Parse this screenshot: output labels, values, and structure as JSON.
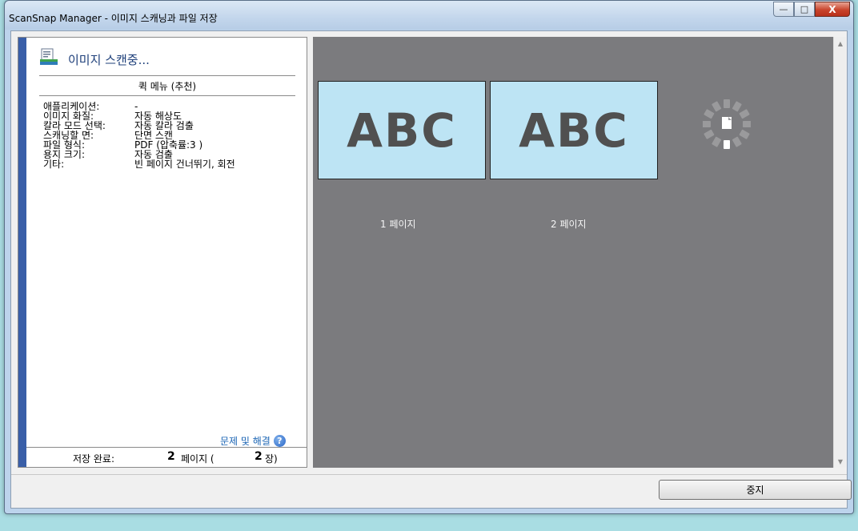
{
  "window": {
    "title": "ScanSnap Manager - 이미지 스캐닝과 파일 저장",
    "controls": {
      "minimize": "—",
      "maximize": "□",
      "close": "X"
    }
  },
  "left_panel": {
    "status": "이미지 스캔중...",
    "quick_menu_title": "퀵 메뉴 (추천)",
    "settings": [
      {
        "label": "애플리케이션:",
        "value": "-"
      },
      {
        "label": "이미지 화질:",
        "value": "자동 해상도"
      },
      {
        "label": "칼라 모드 선택:",
        "value": "자동 칼라 검출"
      },
      {
        "label": "스캐닝할 면:",
        "value": "단면 스캔"
      },
      {
        "label": "파일 형식:",
        "value": "PDF (압축률:3 )"
      },
      {
        "label": "용지 크기:",
        "value": "자동 검출"
      },
      {
        "label": "기타:",
        "value": "빈 페이지 건너뛰기, 회전"
      }
    ],
    "help_link": "문제 및 해결",
    "help_icon_glyph": "?",
    "saved_label": "저장 완료:",
    "pages_value": "2",
    "pages_label": "페이지 (",
    "sheets_value": "2",
    "sheets_label": "장)"
  },
  "preview": {
    "pages": [
      {
        "text": "ABC",
        "label": "1 페이지"
      },
      {
        "text": "ABC",
        "label": "2 페이지"
      }
    ]
  },
  "scrollbar": {
    "up_arrow": "▲",
    "down_arrow": "▼"
  },
  "footer": {
    "stop_button": "중지"
  },
  "colors": {
    "desktop": "#a9dde3",
    "preview_bg": "#7b7b7e",
    "thumb_bg": "#bde4f4",
    "accent": "#3a5fa8",
    "link": "#1a64b4"
  }
}
